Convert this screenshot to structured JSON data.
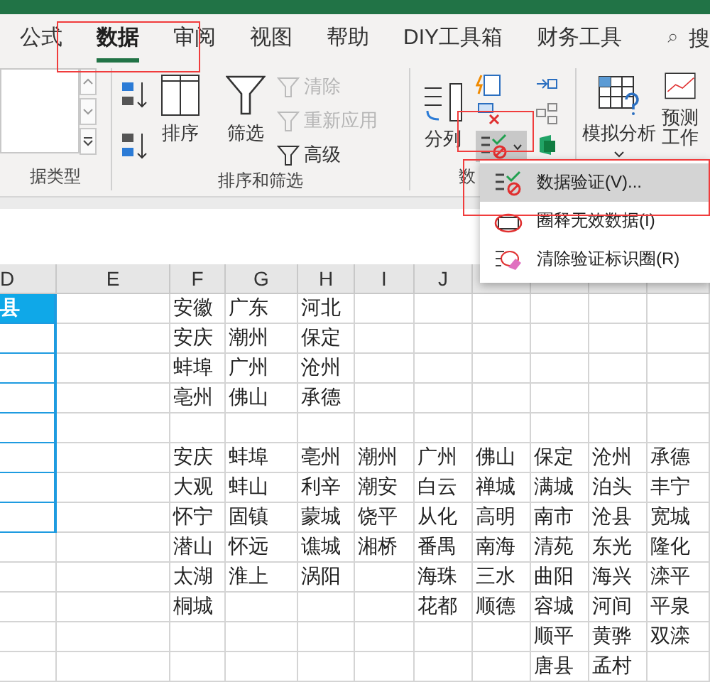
{
  "tabs": [
    {
      "label": "公式",
      "selected": false
    },
    {
      "label": "数据",
      "selected": true
    },
    {
      "label": "审阅",
      "selected": false
    },
    {
      "label": "视图",
      "selected": false
    },
    {
      "label": "帮助",
      "selected": false
    },
    {
      "label": "DIY工具箱",
      "selected": false
    },
    {
      "label": "财务工具",
      "selected": false
    }
  ],
  "search_label": "搜",
  "ribbon": {
    "datatype_group": {
      "label": "据类型"
    },
    "sort_group": {
      "label": "排序和筛选",
      "sort": "排序",
      "filter": "筛选",
      "filter_commands": [
        {
          "label": "清除",
          "disabled": true
        },
        {
          "label": "重新应用",
          "disabled": true
        },
        {
          "label": "高级",
          "disabled": false
        }
      ]
    },
    "tools_group": {
      "label": "数",
      "text_to_columns": "分列",
      "validation_expanded": true
    },
    "forecast_group": {
      "what_if": "模拟分析",
      "forecast": "预测",
      "forecast_sheet": "工作"
    }
  },
  "menu": [
    {
      "label": "数据验证(V)...",
      "selected": true,
      "kind": "validate"
    },
    {
      "label": "圈释无效数据(I)",
      "selected": false,
      "kind": "circle"
    },
    {
      "label": "清除验证标识圈(R)",
      "selected": false,
      "kind": "clear"
    }
  ],
  "columns": [
    "D",
    "E",
    "F",
    "G",
    "H",
    "I",
    "J"
  ],
  "rows": [
    {
      "d": "县",
      "filled": true,
      "in_range": true,
      "cells": [
        "安徽",
        "广东",
        "河北",
        "",
        "",
        "",
        "",
        "",
        ""
      ]
    },
    {
      "d": "",
      "filled": false,
      "in_range": true,
      "cells": [
        "安庆",
        "潮州",
        "保定",
        "",
        "",
        "",
        "",
        "",
        ""
      ]
    },
    {
      "d": "",
      "filled": false,
      "in_range": true,
      "cells": [
        "蚌埠",
        "广州",
        "沧州",
        "",
        "",
        "",
        "",
        "",
        ""
      ]
    },
    {
      "d": "",
      "filled": false,
      "in_range": true,
      "cells": [
        "亳州",
        "佛山",
        "承德",
        "",
        "",
        "",
        "",
        "",
        ""
      ]
    },
    {
      "d": "",
      "filled": false,
      "in_range": true,
      "cells": [
        "",
        "",
        "",
        "",
        "",
        "",
        "",
        "",
        ""
      ]
    },
    {
      "d": "",
      "filled": false,
      "in_range": true,
      "cells": [
        "安庆",
        "蚌埠",
        "亳州",
        "潮州",
        "广州",
        "佛山",
        "保定",
        "沧州",
        "承德"
      ]
    },
    {
      "d": "",
      "filled": false,
      "in_range": true,
      "cells": [
        "大观",
        "蚌山",
        "利辛",
        "潮安",
        "白云",
        "禅城",
        "满城",
        "泊头",
        "丰宁"
      ]
    },
    {
      "d": "",
      "filled": false,
      "in_range": true,
      "cells": [
        "怀宁",
        "固镇",
        "蒙城",
        "饶平",
        "从化",
        "高明",
        "南市",
        "沧县",
        "宽城"
      ]
    },
    {
      "d": "",
      "filled": false,
      "in_range": false,
      "cells": [
        "潜山",
        "怀远",
        "谯城",
        "湘桥",
        "番禺",
        "南海",
        "清苑",
        "东光",
        "隆化"
      ]
    },
    {
      "d": "",
      "filled": false,
      "in_range": false,
      "cells": [
        "太湖",
        "淮上",
        "涡阳",
        "",
        "海珠",
        "三水",
        "曲阳",
        "海兴",
        "滦平"
      ]
    },
    {
      "d": "",
      "filled": false,
      "in_range": false,
      "cells": [
        "桐城",
        "",
        "",
        "",
        "花都",
        "顺德",
        "容城",
        "河间",
        "平泉"
      ]
    },
    {
      "d": "",
      "filled": false,
      "in_range": false,
      "cells": [
        "",
        "",
        "",
        "",
        "",
        "",
        "顺平",
        "黄骅",
        "双滦"
      ]
    },
    {
      "d": "",
      "filled": false,
      "in_range": false,
      "cells": [
        "",
        "",
        "",
        "",
        "",
        "",
        "唐县",
        "孟村",
        ""
      ]
    }
  ]
}
